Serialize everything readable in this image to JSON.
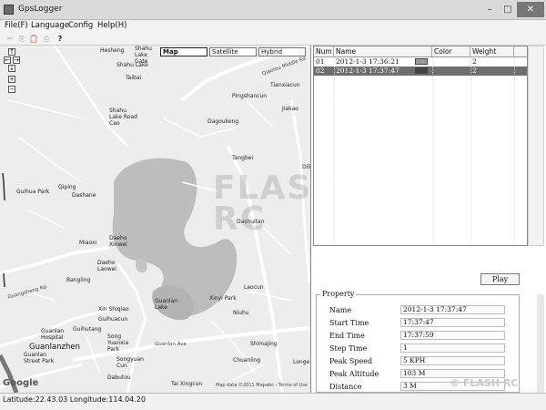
{
  "window": {
    "title": "GpsLogger",
    "min_glyph": "–",
    "max_glyph": "□",
    "close_glyph": "✕"
  },
  "menu": [
    "File(F)",
    "Language",
    "Config",
    "Help(H)"
  ],
  "toolbar_icons": [
    "cut-icon",
    "copy-icon",
    "paste-icon",
    "print-icon",
    "help-icon"
  ],
  "toolbar_glyphs": [
    "✂",
    "⎘",
    "📋",
    "⎙",
    "?"
  ],
  "map": {
    "types": [
      "Map",
      "Satellite",
      "Hybrid"
    ],
    "zoom": {
      "in": "+",
      "out": "−"
    },
    "pan_glyphs": [
      "↑",
      "←",
      "→",
      "↓"
    ],
    "google": "Google",
    "copyright": "Map data ©2011 Mapabc - Terms of Use",
    "places": {
      "hesheng": "Hesheng",
      "shahu_lake_gate": "Shahu Lake Gate",
      "shahu_lake": "Shahu Lake",
      "qiaotou_middle_rd": "Qiaotou Middle Rd",
      "taibai": "Taibai",
      "tianxiacun": "Tianxiacun",
      "pingshancun": "Pingshancun",
      "jiakao": "Jiakao",
      "shahu_road_cao": "Shahu Lake Road Cao",
      "dagoukeng": "Dagoukeng",
      "tangbei": "Tangbei",
      "dili": "Dili",
      "qiping": "Qiping",
      "guihua_park": "Guihua Park",
      "dashane": "Dashane",
      "dashuitan": "Dashuitan",
      "miaoxi": "Miaoxi",
      "daeho_xinwei": "Daeho Xinwei",
      "daeho_laowei": "Daeho Laowei",
      "bangling": "Bangling",
      "guangsheng_rd": "Guangsheng Rd",
      "laocun": "Laocun",
      "xin_shiqiao": "Xin Shiqiao",
      "guihuacun": "Guihuacun",
      "guanlan_lake": "Guanlan Lake",
      "xinyi_park": "Xinyi Park",
      "niuhu": "Niuhu",
      "guanlan_hospital": "Guanlan Hospital",
      "guihutang": "Guihutang",
      "song_yuanxia_park": "Song Yuanxia Park",
      "guanlanzhen": "Guanlanzhen",
      "guanlan_ave": "Guanlan Ave",
      "shimajing": "Shimajing",
      "songyuan_cun": "Songyuan Cun",
      "chuanling": "Chuanling",
      "guanlan_street_park": "Guanlan Street Park",
      "dabutou": "Dabutou",
      "tai_xingcun": "Tai Xingcun",
      "longe": "Longe"
    }
  },
  "status": "Latitude:22.43.03 Longitude:114.04.20",
  "watermark": {
    "logo": "FLASH RC",
    "text": "© FLASH RC"
  },
  "tracks": {
    "columns": [
      "Num",
      "Name",
      "Color",
      "Weight"
    ],
    "rows": [
      {
        "num": "01",
        "name": "2012-1-3 17:36:21",
        "weight": "2",
        "color": "#9a9a9a",
        "selected": false
      },
      {
        "num": "02",
        "name": "2012-1-3 17:37:47",
        "weight": "2",
        "color": "#444444",
        "selected": true
      }
    ]
  },
  "play_label": "Play",
  "property": {
    "title": "Property",
    "fields": [
      {
        "label": "Name",
        "value": "2012-1-3 17:37:47"
      },
      {
        "label": "Start Time",
        "value": "17:37:47"
      },
      {
        "label": "End Time",
        "value": "17:37:59"
      },
      {
        "label": "Step Time",
        "value": "1"
      },
      {
        "label": "Peak Speed",
        "value": "5 KPH"
      },
      {
        "label": "Peak Altitude",
        "value": "103 M"
      },
      {
        "label": "Distance",
        "value": "3 M"
      }
    ]
  }
}
